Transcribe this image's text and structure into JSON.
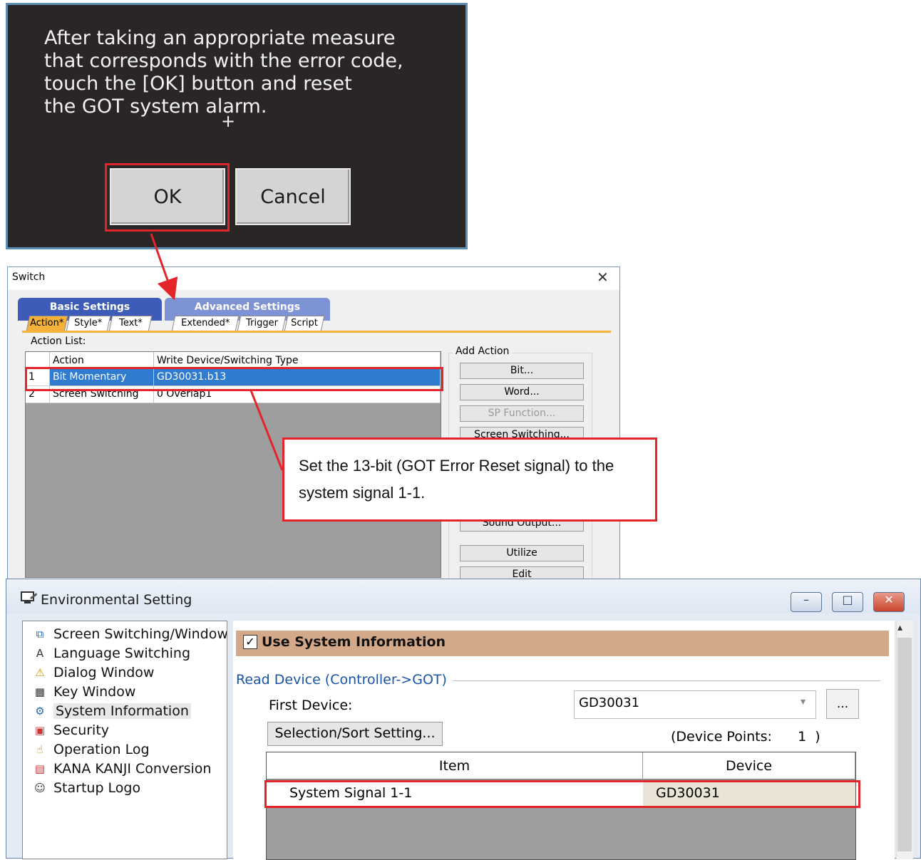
{
  "got_dialog": {
    "message": "After taking an appropriate measure\nthat corresponds with the error code,\ntouch the [OK] button and reset\nthe GOT system alarm.",
    "ok_label": "OK",
    "cancel_label": "Cancel"
  },
  "switch_dialog": {
    "title": "Switch",
    "close_glyph": "✕",
    "group_tabs": [
      "Basic Settings",
      "Advanced Settings"
    ],
    "sub_tabs": [
      "Action*",
      "Style*",
      "Text*",
      "Extended*",
      "Trigger",
      "Script"
    ],
    "action_list_label": "Action List:",
    "columns": [
      "Action",
      "Write Device/Switching Type"
    ],
    "rows": [
      {
        "num": "1",
        "action": "Bit Momentary",
        "device": "GD30031.b13"
      },
      {
        "num": "2",
        "action": "Screen Switching",
        "device": "0 Overlap1"
      }
    ],
    "add_action_label": "Add Action",
    "add_action_buttons": [
      "Bit...",
      "Word...",
      "SP Function...",
      "Screen Switching...",
      "Sound Output...",
      "Utilize",
      "Edit"
    ]
  },
  "callout": {
    "text": "Set the 13-bit (GOT Error Reset signal) to the system signal 1-1."
  },
  "env_dialog": {
    "title": "Environmental Setting",
    "window_buttons": [
      "–",
      "□",
      "✕"
    ],
    "tree_items": [
      {
        "label": "Screen Switching/Window",
        "icon": "screen-switching-icon",
        "glyph": "⧉"
      },
      {
        "label": "Language Switching",
        "icon": "language-icon",
        "glyph": "A"
      },
      {
        "label": "Dialog Window",
        "icon": "warning-icon",
        "glyph": "⚠"
      },
      {
        "label": "Key Window",
        "icon": "keypad-icon",
        "glyph": "▦"
      },
      {
        "label": "System Information",
        "icon": "system-info-icon",
        "glyph": "⚙"
      },
      {
        "label": "Security",
        "icon": "security-icon",
        "glyph": "▣"
      },
      {
        "label": "Operation Log",
        "icon": "operation-log-icon",
        "glyph": "☝"
      },
      {
        "label": "KANA KANJI Conversion",
        "icon": "kana-kanji-icon",
        "glyph": "▤"
      },
      {
        "label": "Startup Logo",
        "icon": "startup-logo-icon",
        "glyph": "☺"
      }
    ],
    "use_system_info": {
      "label": "Use System Information",
      "checked": true,
      "check_glyph": "✓"
    },
    "read_device_label": "Read Device (Controller->GOT)",
    "first_device_label": "First Device:",
    "first_device_value": "GD30031",
    "browse_label": "...",
    "selection_sort_label": "Selection/Sort Setting...",
    "device_points_text": "(Device Points:      1  )",
    "table_columns": [
      "Item",
      "Device"
    ],
    "table_rows": [
      {
        "item": "System Signal 1-1",
        "device": "GD30031"
      }
    ]
  },
  "colors": {
    "highlight": "#e3242b",
    "selection": "#2f7bd0",
    "use_sys_band": "#d4a98a",
    "tab_active": "#f4b23a"
  }
}
